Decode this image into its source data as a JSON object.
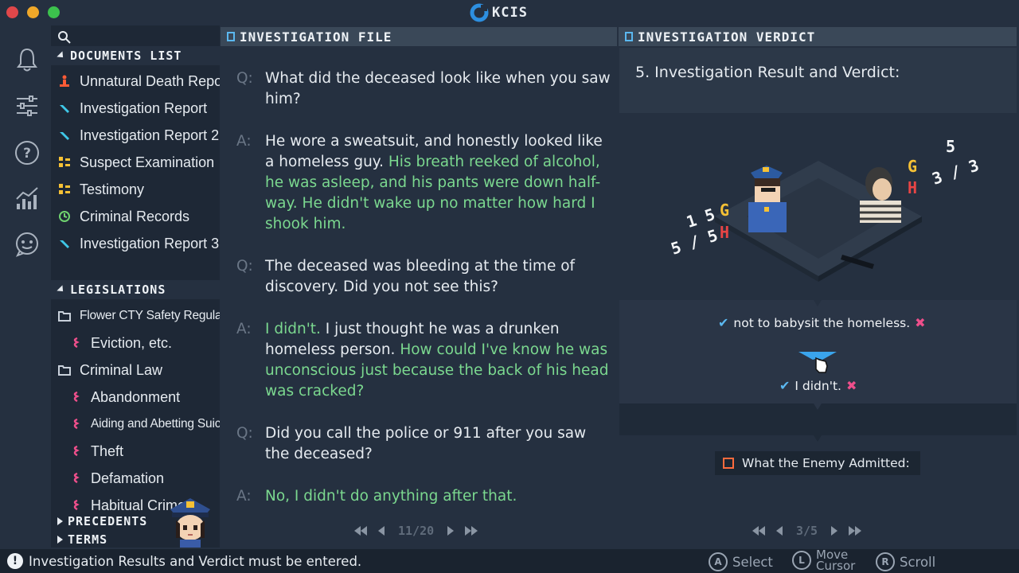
{
  "app": {
    "brand": "KCIS"
  },
  "rail": {
    "icons": [
      "bell-icon",
      "sliders-icon",
      "help-icon",
      "chart-icon",
      "chat-icon"
    ]
  },
  "sidebar": {
    "documents_title": "DOCUMENTS LIST",
    "documents": [
      {
        "label": "Unnatural Death Report",
        "icon": "body-icon",
        "color": "#ff5b36"
      },
      {
        "label": "Investigation Report",
        "icon": "pen-icon",
        "color": "#3fc8e8"
      },
      {
        "label": "Investigation Report 2",
        "icon": "pen-icon",
        "color": "#3fc8e8"
      },
      {
        "label": "Suspect Examination",
        "icon": "grid-icon",
        "color": "#f6c135"
      },
      {
        "label": "Testimony",
        "icon": "grid-icon",
        "color": "#f6c135"
      },
      {
        "label": "Criminal Records",
        "icon": "clock-icon",
        "color": "#6fd36f"
      },
      {
        "label": "Investigation Report 3",
        "icon": "pen-icon",
        "color": "#3fc8e8"
      }
    ],
    "legislations_title": "LEGISLATIONS",
    "legislations": [
      {
        "label": "Flower CTY Safety Regulations",
        "type": "folder"
      },
      {
        "label": "Eviction, etc.",
        "type": "law"
      },
      {
        "label": "Criminal Law",
        "type": "folder"
      },
      {
        "label": "Abandonment",
        "type": "law"
      },
      {
        "label": "Aiding and Abetting Suicide",
        "type": "law"
      },
      {
        "label": "Theft",
        "type": "law"
      },
      {
        "label": "Defamation",
        "type": "law"
      },
      {
        "label": "Habitual Crime",
        "type": "law"
      }
    ],
    "precedents_title": "PRECEDENTS",
    "terms_title": "TERMS"
  },
  "investigation_file": {
    "title": "INVESTIGATION FILE",
    "entries": [
      {
        "label": "Q:",
        "segments": [
          {
            "t": "What did the deceased look like when you saw him?",
            "hl": false
          }
        ]
      },
      {
        "label": "A:",
        "segments": [
          {
            "t": "He wore a sweatsuit, and honestly looked like a homeless guy. ",
            "hl": false
          },
          {
            "t": "His breath reeked of alcohol, he was asleep, and his pants were down half-way. He didn't wake up no matter how hard I shook him.",
            "hl": true
          }
        ]
      },
      {
        "label": "Q:",
        "segments": [
          {
            "t": "The deceased was bleeding at the time of discovery. Did you not see this?",
            "hl": false
          }
        ]
      },
      {
        "label": "A:",
        "segments": [
          {
            "t": "I didn't.",
            "hl": true
          },
          {
            "t": " I just thought he was a drunken homeless person. ",
            "hl": false
          },
          {
            "t": "How could I've know he was unconscious just because the back of his head was cracked?",
            "hl": true
          }
        ]
      },
      {
        "label": "Q:",
        "segments": [
          {
            "t": "Did you call the police or 911 after you saw the deceased?",
            "hl": false
          }
        ]
      },
      {
        "label": "A:",
        "segments": [
          {
            "t": "No, I didn't do anything after that.",
            "hl": true
          }
        ]
      }
    ],
    "page": "11/20"
  },
  "verdict": {
    "title": "INVESTIGATION VERDICT",
    "heading": "5. Investigation Result and Verdict:",
    "officer_stats": {
      "top": "1 5",
      "bottom": "5 / 5",
      "g": "G",
      "h": "H"
    },
    "suspect_stats": {
      "top": "5",
      "bottom": "3 / 3",
      "g": "G",
      "h": "H"
    },
    "answer1": "not to babysit the homeless.",
    "answer2": "I didn't.",
    "admitted_label": "What the Enemy Admitted:",
    "page": "3/5"
  },
  "status": {
    "message": "Investigation Results and Verdict must be entered.",
    "hints": [
      {
        "button": "A",
        "label": "Select"
      },
      {
        "button": "L",
        "label": "Move\nCursor"
      },
      {
        "button": "R",
        "label": "Scroll"
      }
    ]
  },
  "colors": {
    "highlight": "#7bd88f",
    "check": "#5bb8f0",
    "cross": "#ee4f8b"
  }
}
